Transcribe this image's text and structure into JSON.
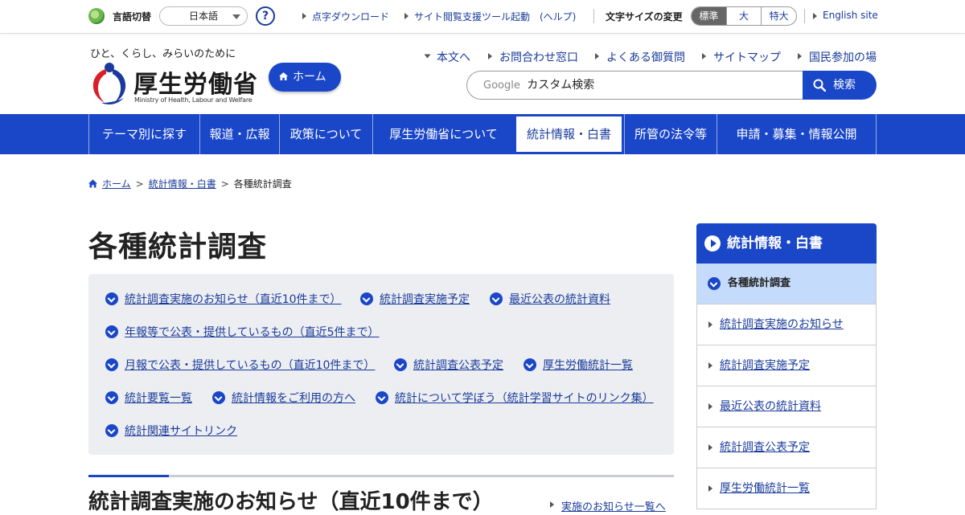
{
  "utility": {
    "language_label": "言語切替",
    "language_value": "日本語",
    "help_label": "?",
    "links": [
      "点字ダウンロード",
      "サイト閲覧支援ツール起動　(ヘルプ)"
    ],
    "font_size_label": "文字サイズの変更",
    "font_sizes": [
      "標準",
      "大",
      "特大"
    ],
    "english_link": "English site"
  },
  "header": {
    "tagline": "ひと、くらし、みらいのために",
    "logo_text": "厚生労働省",
    "logo_sub": "Ministry of Health, Labour and Welfare",
    "home_button": "ホーム",
    "links": [
      "本文へ",
      "お問合わせ窓口",
      "よくある御質問",
      "サイトマップ",
      "国民参加の場"
    ],
    "search_brand": "Google",
    "search_placeholder": "カスタム検索",
    "search_button": "検索"
  },
  "global_nav": {
    "items": [
      "テーマ別に探す",
      "報道・広報",
      "政策について",
      "厚生労働省について",
      "統計情報・白書",
      "所管の法令等",
      "申請・募集・情報公開"
    ],
    "active_index": 4
  },
  "breadcrumb": {
    "items": [
      "ホーム",
      "統計情報・白書",
      "各種統計調査"
    ]
  },
  "main": {
    "title": "各種統計調査",
    "panel_links": [
      "統計調査実施のお知らせ（直近10件まで）",
      "統計調査実施予定",
      "最近公表の統計資料",
      "年報等で公表・提供しているもの（直近5件まで）",
      "月報で公表・提供しているもの（直近10件まで）",
      "統計調査公表予定",
      "厚生労働統計一覧",
      "統計要覧一覧",
      "統計情報をご利用の方へ",
      "統計について学ぼう（統計学習サイトのリンク集）",
      "統計関連サイトリンク"
    ],
    "section_title": "統計調査実施のお知らせ（直近10件まで）",
    "section_more": "実施のお知らせ一覧へ"
  },
  "side": {
    "heading": "統計情報・白書",
    "current": "各種統計調査",
    "items": [
      "統計調査実施のお知らせ",
      "統計調査実施予定",
      "最近公表の統計資料",
      "統計調査公表予定",
      "厚生労働統計一覧"
    ]
  },
  "colors": {
    "brand_blue": "#1a46c8",
    "link_blue": "#1a3b9c",
    "panel_bg": "#eceef1",
    "side_current_bg": "#c4dbfb"
  }
}
